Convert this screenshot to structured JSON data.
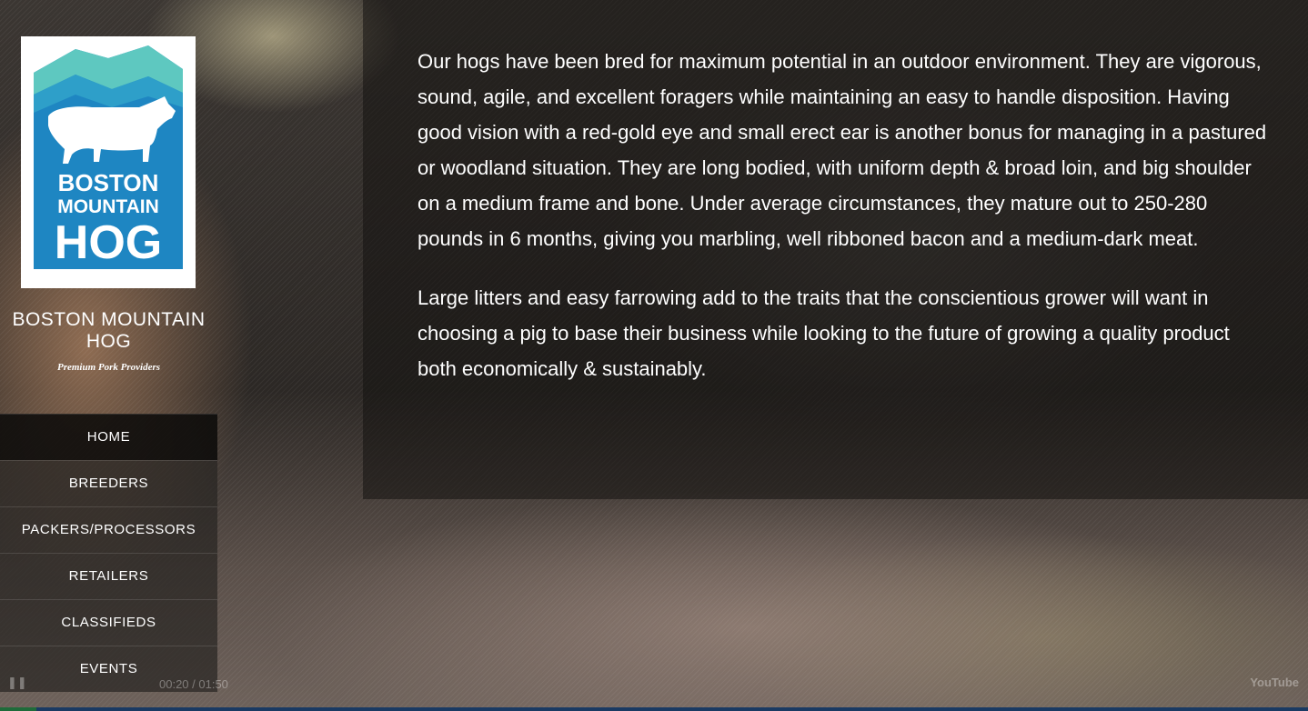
{
  "brand": {
    "name": "BOSTON MOUNTAIN HOG",
    "tagline": "Premium Pork Providers",
    "logo_text": [
      "BOSTON",
      "MOUNTAIN",
      "HOG"
    ],
    "logo_colors": {
      "mountain_light": "#5ec8c0",
      "mountain_mid": "#2e9fc9",
      "badge": "#1e86c2",
      "pig": "#ffffff"
    }
  },
  "nav": {
    "items": [
      {
        "label": "HOME",
        "active": true
      },
      {
        "label": "BREEDERS",
        "active": false
      },
      {
        "label": "PACKERS/PROCESSORS",
        "active": false
      },
      {
        "label": "RETAILERS",
        "active": false
      },
      {
        "label": "CLASSIFIEDS",
        "active": false
      },
      {
        "label": "EVENTS",
        "active": false
      }
    ]
  },
  "content": {
    "paragraphs": [
      "Our hogs have been bred for maximum potential in an outdoor environment. They are vigorous, sound, agile, and excellent foragers while maintaining an easy to handle disposition. Having good vision with a red-gold eye and small erect ear is another bonus for managing in a pastured or woodland situation. They are long bodied, with uniform depth & broad loin, and big shoulder on a medium frame and bone. Under average circumstances, they mature out to 250-280 pounds in 6 months, giving you marbling, well ribboned bacon and a medium-dark meat.",
      "Large litters and easy farrowing add to the traits that the conscientious grower will want in choosing a pig to base their business while looking to the future of growing a quality product both economically & sustainably."
    ]
  },
  "player": {
    "time": "00:20 / 01:50",
    "play_icon": "pause-icon",
    "brand": "YouTube"
  }
}
